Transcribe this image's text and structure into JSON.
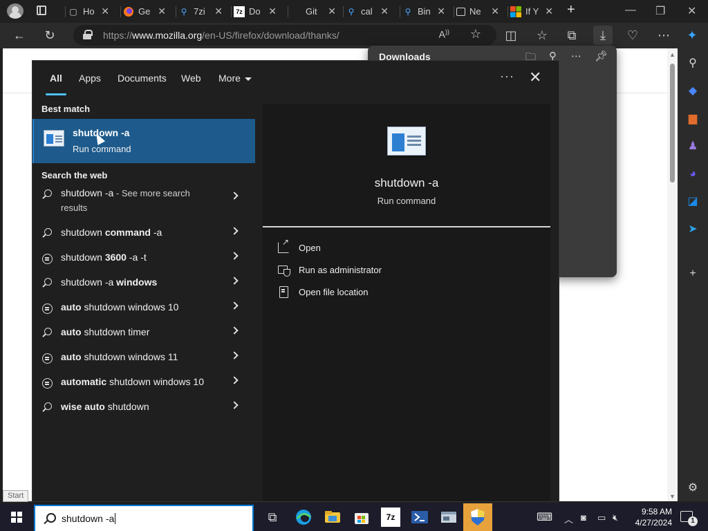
{
  "browser": {
    "tabs": [
      {
        "label": "Ho",
        "icon": "page-icon"
      },
      {
        "label": "Ge",
        "icon": "firefox-icon"
      },
      {
        "label": "7zi",
        "icon": "search-icon"
      },
      {
        "label": "Do",
        "icon": "7z-icon"
      },
      {
        "label": "Git",
        "icon": "github-icon"
      },
      {
        "label": "cal",
        "icon": "search-icon"
      },
      {
        "label": "Bin",
        "icon": "search-icon"
      },
      {
        "label": "Ne",
        "icon": "newtab-icon"
      },
      {
        "label": "If Y",
        "icon": "microsoft-icon"
      }
    ],
    "address": {
      "prefix": "https://",
      "host": "www.mozilla.org",
      "path": "/en-US/firefox/download/thanks/"
    },
    "downloads_panel": {
      "title": "Downloads"
    }
  },
  "search_flyout": {
    "nav_tabs": [
      "All",
      "Apps",
      "Documents",
      "Web",
      "More"
    ],
    "best_match_heading": "Best match",
    "best_match": {
      "title": "shutdown -a",
      "subtitle": "Run command"
    },
    "search_web_heading": "Search the web",
    "web_results": [
      {
        "pre": "",
        "bold": "shutdown -a",
        "post": "",
        "muted": " - See more search results",
        "icon": "search-icon"
      },
      {
        "pre": "shutdown ",
        "bold": "command",
        "post": " -a",
        "icon": "search-icon"
      },
      {
        "pre": "shutdown ",
        "bold": "3600",
        "post": " -a -t",
        "icon": "bubble-icon"
      },
      {
        "pre": "shutdown -a ",
        "bold": "windows",
        "post": "",
        "icon": "search-icon"
      },
      {
        "pre": "",
        "bold": "auto",
        "post": " shutdown windows 10",
        "icon": "bubble-icon"
      },
      {
        "pre": "",
        "bold": "auto",
        "post": " shutdown timer",
        "icon": "search-icon"
      },
      {
        "pre": "",
        "bold": "auto",
        "post": " shutdown windows 11",
        "icon": "bubble-icon"
      },
      {
        "pre": "",
        "bold": "automatic",
        "post": " shutdown windows 10",
        "icon": "bubble-icon"
      },
      {
        "pre": "",
        "bold": "wise auto",
        "post": " shutdown",
        "icon": "search-icon"
      }
    ],
    "preview": {
      "title": "shutdown -a",
      "subtitle": "Run command",
      "actions": [
        "Open",
        "Run as administrator",
        "Open file location"
      ]
    }
  },
  "taskbar": {
    "start_label": "Start",
    "search_value": "shutdown -a",
    "time": "9:58 AM",
    "date": "4/27/2024",
    "notification_count": "1"
  },
  "colors": {
    "accent": "#4cc2ff",
    "selection": "#1e5b8c",
    "taskbar": "#1c1c2a"
  }
}
